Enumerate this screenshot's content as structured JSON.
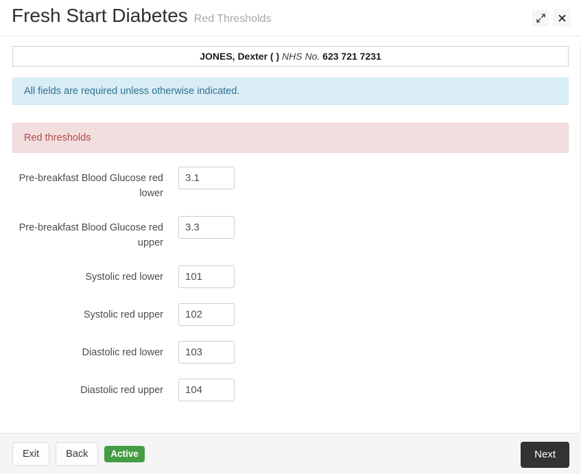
{
  "header": {
    "title": "Fresh Start Diabetes",
    "subtitle": "Red Thresholds",
    "expand_icon": "expand-diagonal-icon",
    "close_icon": "close-icon"
  },
  "patient": {
    "name": "JONES, Dexter ( )",
    "nhs_label": "NHS No.",
    "nhs_number": "623 721 7231"
  },
  "alert": {
    "text": "All fields are required unless otherwise indicated."
  },
  "panel": {
    "heading": "Red thresholds"
  },
  "fields": [
    {
      "label": "Pre-breakfast Blood Glucose red lower",
      "value": "3.1",
      "name": "prebreakfast-blood-glucose-red-lower"
    },
    {
      "label": "Pre-breakfast Blood Glucose red upper",
      "value": "3.3",
      "name": "prebreakfast-blood-glucose-red-upper"
    },
    {
      "label": "Systolic red lower",
      "value": "101",
      "name": "systolic-red-lower"
    },
    {
      "label": "Systolic red upper",
      "value": "102",
      "name": "systolic-red-upper"
    },
    {
      "label": "Diastolic red lower",
      "value": "103",
      "name": "diastolic-red-lower"
    },
    {
      "label": "Diastolic red upper",
      "value": "104",
      "name": "diastolic-red-upper"
    }
  ],
  "footer": {
    "exit_label": "Exit",
    "back_label": "Back",
    "status_label": "Active",
    "next_label": "Next"
  },
  "colors": {
    "info_bg": "#d9edf7",
    "info_text": "#31708f",
    "danger_bg": "#f2dede",
    "danger_text": "#b04a4a",
    "success_badge": "#449d44",
    "next_button": "#333333",
    "footer_bg": "#f5f5f5"
  }
}
